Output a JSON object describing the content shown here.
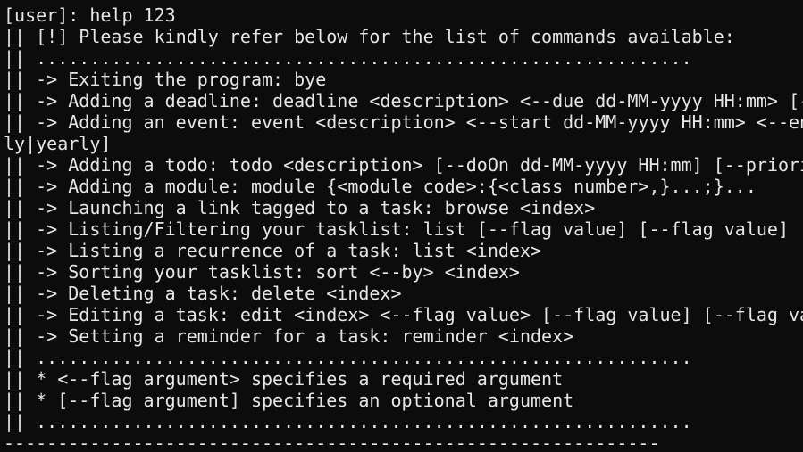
{
  "terminal": {
    "lines": [
      "[user]: help 123",
      "|| [!] Please kindly refer below for the list of commands available:",
      "|| .............................................................",
      "|| -> Exiting the program: bye",
      "|| -> Adding a deadline: deadline <description> <--due dd-MM-yyyy HH:mm> [--",
      "|| -> Adding an event: event <description> <--start dd-MM-yyyy HH:mm> <--en",
      "ly|yearly]",
      "|| -> Adding a todo: todo <description> [--doOn dd-MM-yyyy HH:mm] [--priori",
      "|| -> Adding a module: module {<module code>:{<class number>,}...;}...",
      "|| -> Launching a link tagged to a task: browse <index>",
      "|| -> Listing/Filtering your tasklist: list [--flag value] [--flag value] .",
      "|| -> Listing a recurrence of a task: list <index>",
      "|| -> Sorting your tasklist: sort <--by> <index>",
      "|| -> Deleting a task: delete <index>",
      "|| -> Editing a task: edit <index> <--flag value> [--flag value] [--flag va",
      "|| -> Setting a reminder for a task: reminder <index>",
      "|| .............................................................",
      "|| * <--flag argument> specifies a required argument",
      "|| * [--flag argument] specifies an optional argument",
      "|| .............................................................",
      "-------------------------------------------------------------"
    ]
  }
}
